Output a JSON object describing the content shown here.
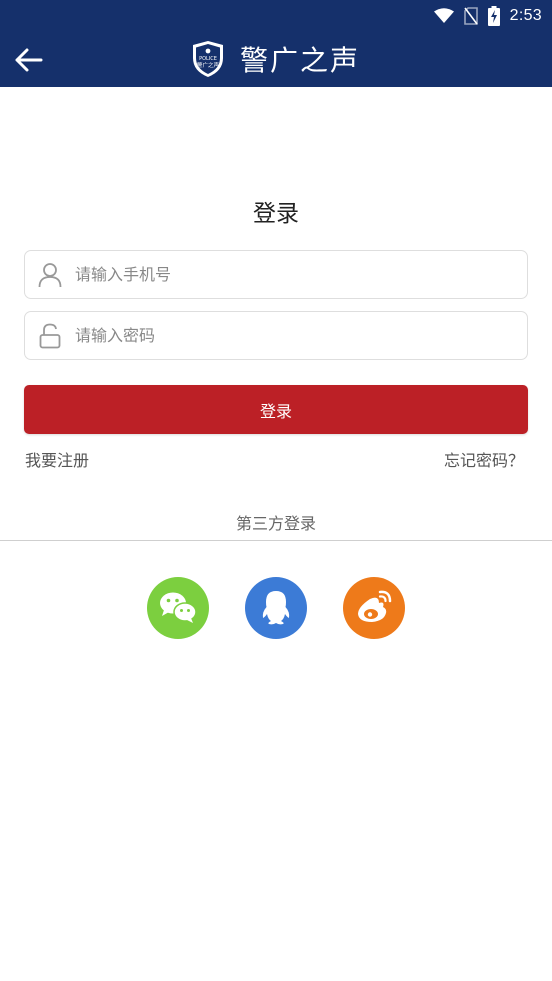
{
  "status_bar": {
    "time": "2:53",
    "icons": [
      "wifi-icon",
      "no-sim-icon",
      "battery-charging-icon"
    ]
  },
  "header": {
    "title": "警广之声",
    "back_icon": "back-arrow-icon",
    "logo": {
      "icon": "police-badge-logo",
      "text_top": "POLICE",
      "text_main": "警广之声"
    }
  },
  "login": {
    "title": "登录",
    "phone": {
      "placeholder": "请输入手机号",
      "value": "",
      "icon": "user-icon"
    },
    "password": {
      "placeholder": "请输入密码",
      "value": "",
      "icon": "lock-icon"
    },
    "submit_label": "登录",
    "register_label": "我要注册",
    "forgot_label": "忘记密码？"
  },
  "third_party": {
    "label": "第三方登录",
    "providers": [
      {
        "name": "wechat",
        "icon": "wechat-icon",
        "color": "#7ccf3f"
      },
      {
        "name": "qq",
        "icon": "qq-icon",
        "color": "#3c7bd6"
      },
      {
        "name": "weibo",
        "icon": "weibo-icon",
        "color": "#ee7a1a"
      }
    ]
  },
  "colors": {
    "primary": "#15306b",
    "accent": "#bc2026",
    "background": "#ffffff"
  }
}
